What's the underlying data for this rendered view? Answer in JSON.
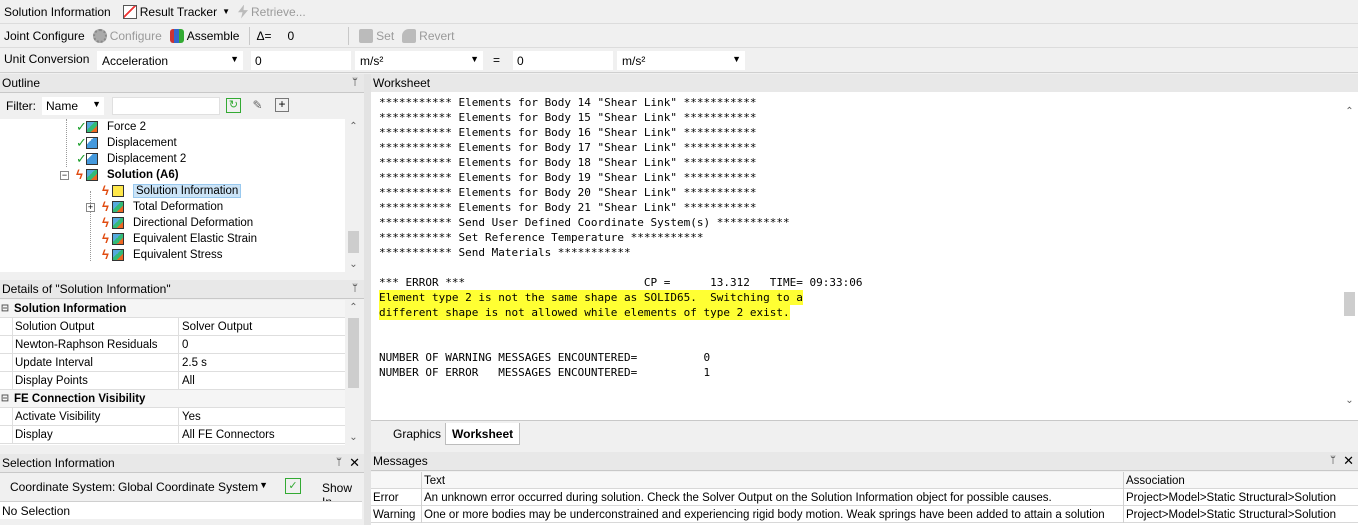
{
  "toolbar1": {
    "solution_information": "Solution Information",
    "result_tracker": "Result Tracker",
    "retrieve": "Retrieve..."
  },
  "toolbar2": {
    "joint_configure": "Joint Configure",
    "configure": "Configure",
    "assemble": "Assemble",
    "delta_label": "Δ=",
    "delta_value": "0",
    "set": "Set",
    "revert": "Revert"
  },
  "unit_conversion": {
    "label": "Unit Conversion",
    "quantity": "Acceleration",
    "value_from": "0",
    "unit_from": "m/s²",
    "equals": "=",
    "value_to": "0",
    "unit_to": "m/s²"
  },
  "outline": {
    "title": "Outline",
    "filter_label": "Filter:",
    "filter_value": "Name",
    "items": [
      {
        "label": "Force 2"
      },
      {
        "label": "Displacement"
      },
      {
        "label": "Displacement 2"
      },
      {
        "label": "Solution (A6)"
      },
      {
        "label": "Solution Information"
      },
      {
        "label": "Total Deformation"
      },
      {
        "label": "Directional Deformation"
      },
      {
        "label": "Equivalent Elastic Strain"
      },
      {
        "label": "Equivalent Stress"
      }
    ]
  },
  "details": {
    "title": "Details of \"Solution Information\"",
    "rows": [
      {
        "group": "Solution Information"
      },
      {
        "k": "Solution Output",
        "v": "Solver Output"
      },
      {
        "k": "Newton-Raphson Residuals",
        "v": "0"
      },
      {
        "k": "Update Interval",
        "v": "2.5 s"
      },
      {
        "k": "Display Points",
        "v": "All"
      },
      {
        "group": "FE Connection Visibility"
      },
      {
        "k": "Activate Visibility",
        "v": "Yes"
      },
      {
        "k": "Display",
        "v": "All FE Connectors"
      }
    ]
  },
  "selection": {
    "title": "Selection Information",
    "coord_label": "Coordinate System:",
    "coord_value": "Global Coordinate System",
    "show_label": "Show In",
    "status": "No Selection"
  },
  "worksheet": {
    "title": "Worksheet",
    "lines": [
      "*********** Elements for Body 14 \"Shear Link\" ***********",
      "*********** Elements for Body 15 \"Shear Link\" ***********",
      "*********** Elements for Body 16 \"Shear Link\" ***********",
      "*********** Elements for Body 17 \"Shear Link\" ***********",
      "*********** Elements for Body 18 \"Shear Link\" ***********",
      "*********** Elements for Body 19 \"Shear Link\" ***********",
      "*********** Elements for Body 20 \"Shear Link\" ***********",
      "*********** Elements for Body 21 \"Shear Link\" ***********",
      "*********** Send User Defined Coordinate System(s) ***********",
      "*********** Set Reference Temperature ***********",
      "*********** Send Materials ***********",
      "",
      "*** ERROR ***                           CP =      13.312   TIME= 09:33:06",
      "Element type 2 is not the same shape as SOLID65.  Switching to a",
      "different shape is not allowed while elements of type 2 exist.",
      "",
      "",
      "NUMBER OF WARNING MESSAGES ENCOUNTERED=          0",
      "NUMBER OF ERROR   MESSAGES ENCOUNTERED=          1"
    ],
    "tabs": [
      "Graphics",
      "Worksheet"
    ]
  },
  "messages": {
    "title": "Messages",
    "columns": [
      "",
      "Text",
      "Association"
    ],
    "rows": [
      {
        "type": "Error",
        "text": "An unknown error occurred during solution.  Check the Solver Output on the Solution Information object for possible causes.",
        "assoc": "Project>Model>Static Structural>Solution"
      },
      {
        "type": "Warning",
        "text": "One or more bodies may be underconstrained and experiencing rigid body motion. Weak springs have been added to attain a solution",
        "assoc": "Project>Model>Static Structural>Solution"
      }
    ]
  },
  "colors": {
    "highlight": "#ffff33",
    "panel_bg": "#f0f0f0",
    "selection_bg": "#cce4f7"
  }
}
